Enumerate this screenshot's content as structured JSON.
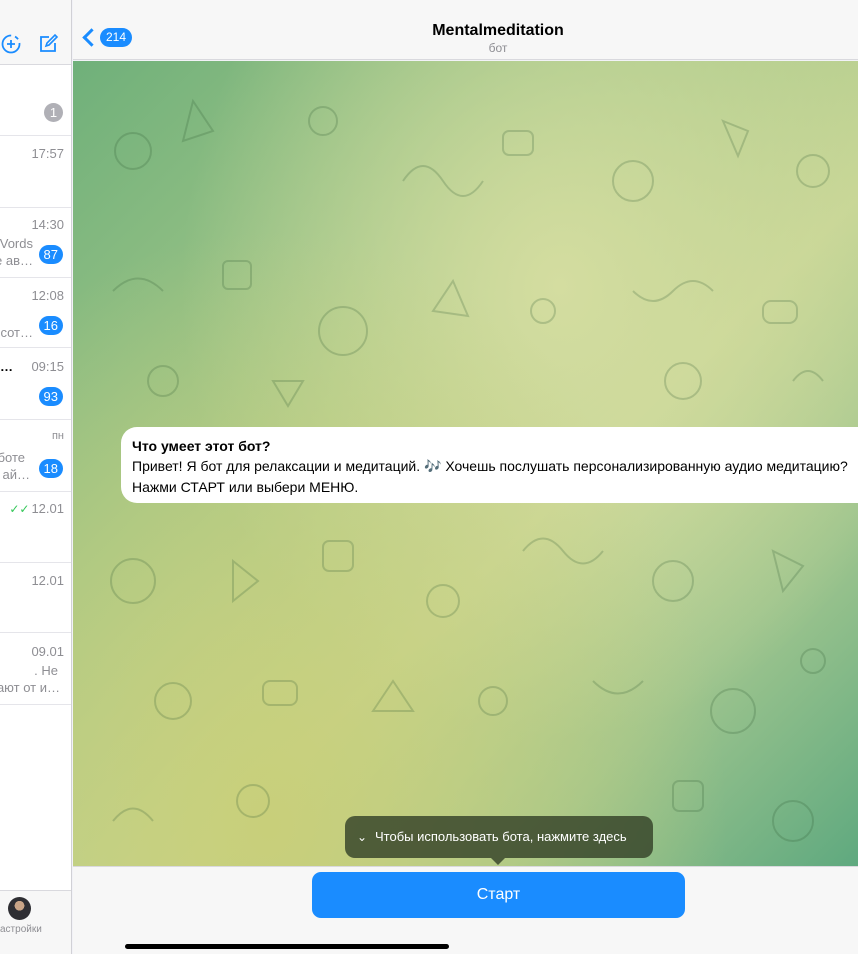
{
  "window": {
    "dots": "•••"
  },
  "sidebar": {
    "unread_count": "1",
    "chats": [
      {
        "time": "17:57",
        "preview": [
          "",
          ""
        ],
        "badge": "",
        "read": false
      },
      {
        "time": "14:30",
        "preview": [
          "Vords",
          "е ав…"
        ],
        "badge": "87",
        "read": false
      },
      {
        "time": "12:08",
        "preview": [
          "",
          "сот…"
        ],
        "badge": "16",
        "read": false
      },
      {
        "time": "09:15",
        "preview": [
          "…",
          ""
        ],
        "badge": "93",
        "read": false
      },
      {
        "time": "пн",
        "preview": [
          "боте",
          "ай…"
        ],
        "badge": "18",
        "read": false
      },
      {
        "time": "12.01",
        "preview": [
          "",
          ""
        ],
        "badge": "",
        "read": true
      },
      {
        "time": "12.01",
        "preview": [
          "",
          ""
        ],
        "badge": "",
        "read": false
      },
      {
        "time": "09.01",
        "preview": [
          ". Не",
          "ают от и…"
        ],
        "badge": "",
        "read": false
      }
    ],
    "settings_label": "астройки"
  },
  "header": {
    "back_count": "214",
    "title": "Mentalmeditation",
    "subtitle": "бот"
  },
  "bot_info": {
    "heading": "Что умеет этот бот?",
    "text": "Привет! Я бот для релаксации и медитаций. 🎶 Хочешь послушать персонализированную аудио медитацию? Нажми СТАРТ или выбери МЕНЮ."
  },
  "tooltip": {
    "text": "Чтобы использовать бота, нажмите здесь"
  },
  "start_button": {
    "label": "Старт"
  },
  "colors": {
    "accent": "#1a8cff",
    "unread_badge": "#1a8cff",
    "read_check": "#34c759"
  }
}
